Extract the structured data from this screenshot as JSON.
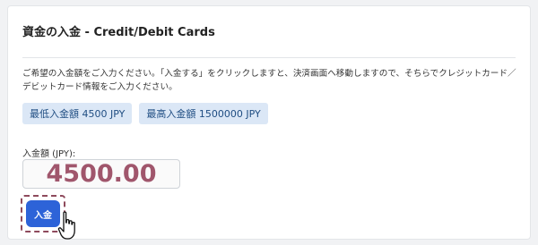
{
  "panel": {
    "title": "資金の入金 - Credit/Debit Cards",
    "description": "ご希望の入金額をご入力ください。「入金する」をクリックしますと、決済画面へ移動しますので、そちらでクレジットカード／デビットカード情報をご入力ください。"
  },
  "limits": {
    "min_label": "最低入金額 4500 JPY",
    "max_label": "最高入金額 1500000 JPY"
  },
  "form": {
    "amount_label": "入金額 (JPY):",
    "amount_value": "4500.00",
    "submit_label": "入金"
  },
  "colors": {
    "accent": "#2d63d8",
    "badge_bg": "#dbe7f6",
    "amount_text": "#a0566c",
    "highlight_border": "#8e4a5c"
  },
  "icons": {
    "cursor": "hand-pointer-icon"
  }
}
